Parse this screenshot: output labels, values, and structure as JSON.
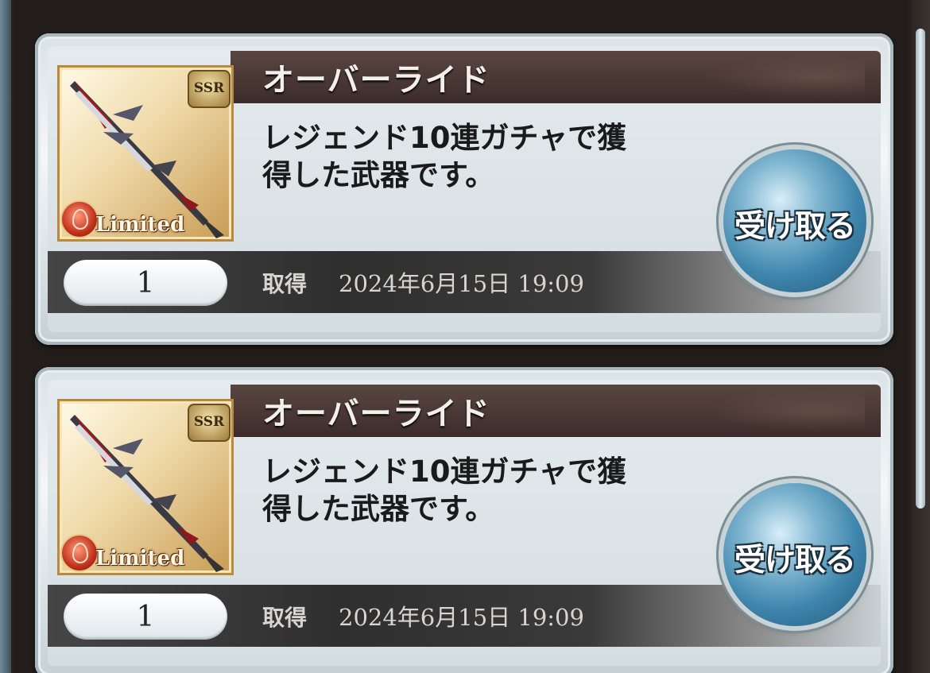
{
  "colors": {
    "title_bar": "#3c2c29",
    "button_blue": "#3f86ad",
    "card_silver": "#d4dde1",
    "rarity_gold": "#c79a52",
    "element_fire": "#c1321c"
  },
  "items": [
    {
      "name": "オーバーライド",
      "description_line1": "レジェンド10連ガチャで獲",
      "description_line2": "得した武器です。",
      "quantity": "1",
      "acquired_label": "取得",
      "acquired_date": "2024年6月15日 19:09",
      "rarity": "SSR",
      "tag": "Limited",
      "element_icon": "fire-element-icon",
      "receive_label": "受け取る"
    },
    {
      "name": "オーバーライド",
      "description_line1": "レジェンド10連ガチャで獲",
      "description_line2": "得した武器です。",
      "quantity": "1",
      "acquired_label": "取得",
      "acquired_date": "2024年6月15日 19:09",
      "rarity": "SSR",
      "tag": "Limited",
      "element_icon": "fire-element-icon",
      "receive_label": "受け取る"
    }
  ]
}
